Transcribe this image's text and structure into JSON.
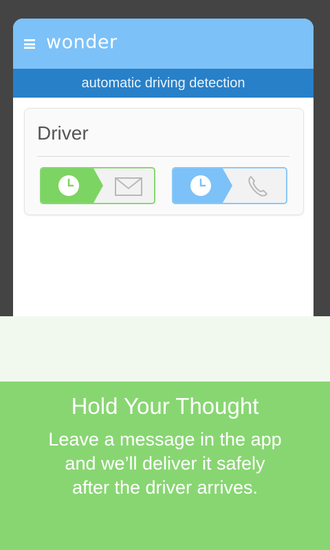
{
  "app": {
    "title": "wonder",
    "detection_label": "automatic driving detection"
  },
  "card": {
    "title": "Driver",
    "actions": [
      {
        "name": "schedule-message",
        "left_icon": "clock-icon",
        "right_icon": "envelope-icon",
        "color": "#7cd462"
      },
      {
        "name": "schedule-call",
        "left_icon": "clock-icon",
        "right_icon": "phone-icon",
        "color": "#7cc1f7"
      }
    ]
  },
  "promo": {
    "headline": "Hold Your Thought",
    "body_lines": [
      "Leave a message in the app",
      "and we’ll deliver it safely",
      "after the driver arrives."
    ]
  },
  "colors": {
    "appbar": "#7cc1f7",
    "detection_bar": "#2880c8",
    "promo_green": "#88d672",
    "promo_light": "#f1f9ef"
  }
}
